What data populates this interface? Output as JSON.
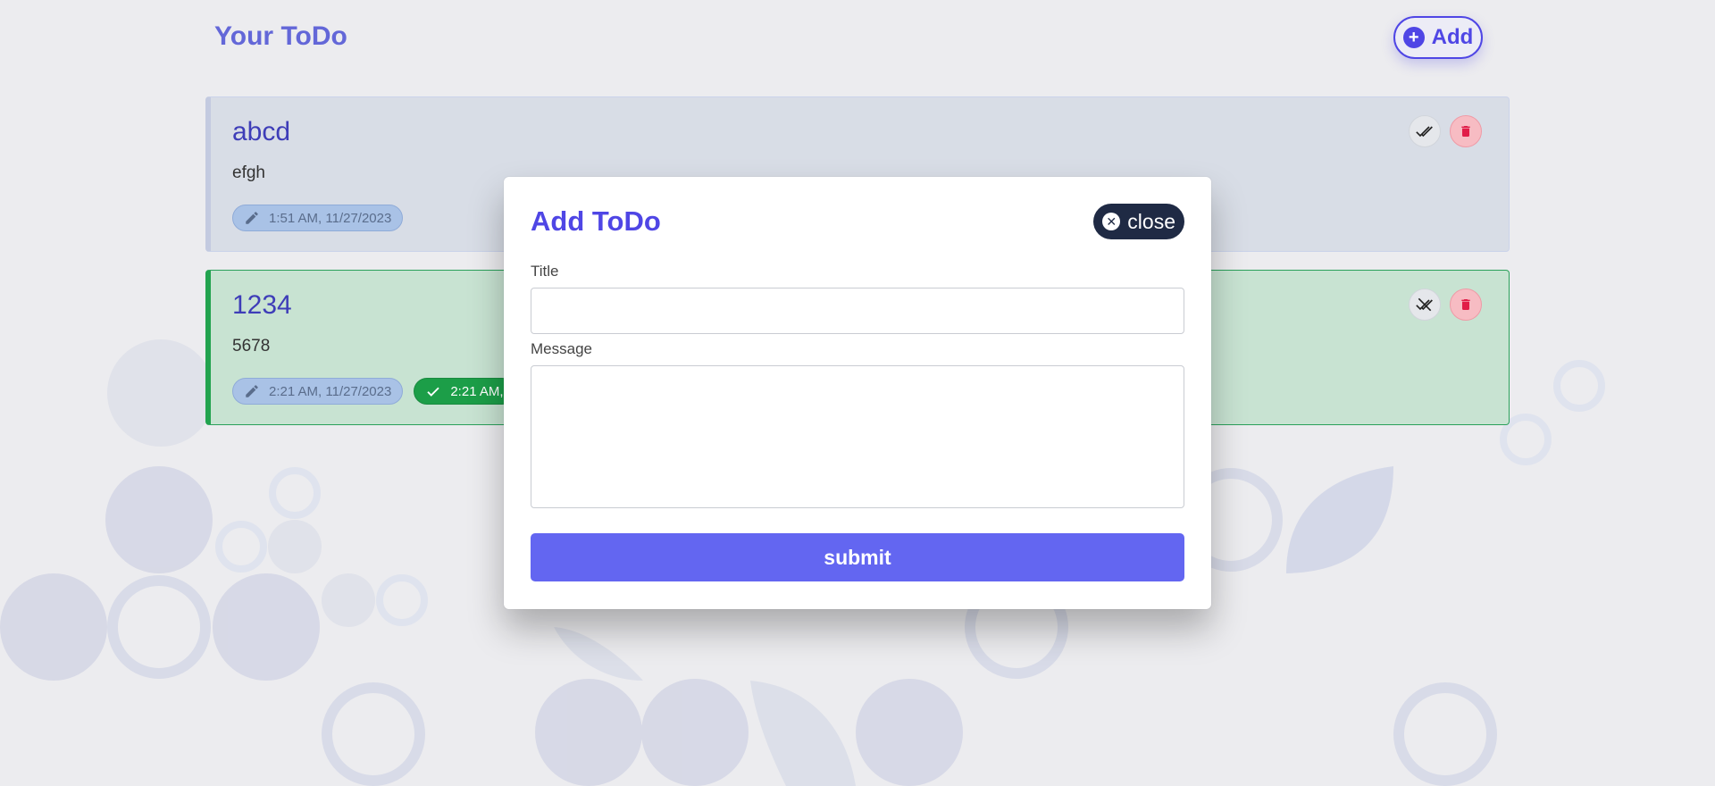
{
  "header": {
    "title": "Your ToDo",
    "add_label": "Add"
  },
  "todos": [
    {
      "title": "abcd",
      "message": "efgh",
      "created": "1:51 AM, 11/27/2023",
      "completed": "",
      "status": "pending"
    },
    {
      "title": "1234",
      "message": "5678",
      "created": "2:21 AM, 11/27/2023",
      "completed": "2:21 AM, ",
      "status": "completed"
    }
  ],
  "modal": {
    "title": "Add ToDo",
    "close_label": "close",
    "title_label": "Title",
    "message_label": "Message",
    "title_value": "",
    "message_value": "",
    "submit_label": "submit"
  },
  "colors": {
    "primary": "#4f46e5",
    "submit": "#6366f1",
    "completed_green": "#1c9e48",
    "delete_pink": "#e11d48",
    "close_dark": "#1f2a44"
  },
  "icons": [
    "plus-circle-icon",
    "double-check-icon",
    "remove-check-icon",
    "trash-icon",
    "pencil-icon",
    "check-icon",
    "close-circle-icon"
  ]
}
